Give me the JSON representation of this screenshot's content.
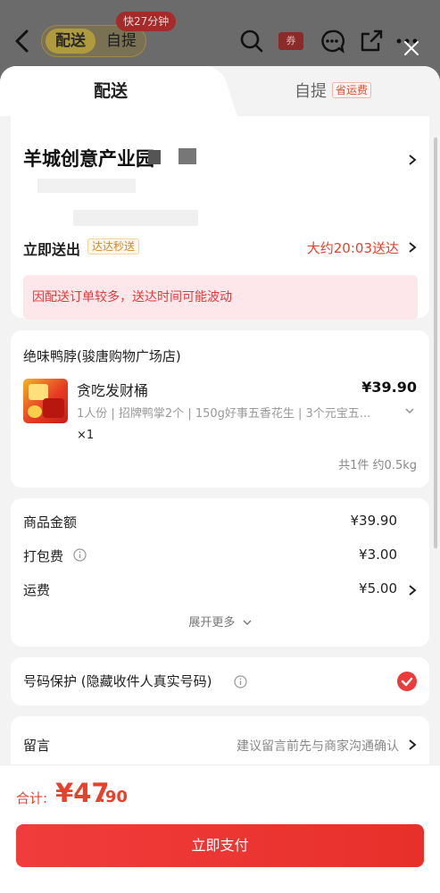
{
  "topbar": {
    "mode_delivery": "配送",
    "mode_pickup": "自提",
    "fast_badge": "快27分钟",
    "coupon_label": "券"
  },
  "tabs": {
    "delivery": "配送",
    "pickup": "自提",
    "pickup_badge": "省运费"
  },
  "address": {
    "title": "羊城创意产业园",
    "deliver_now": "立即送出",
    "fast_tag": "达达秒送",
    "eta": "大约20:03送达",
    "warning": "因配送订单较多，送达时间可能波动"
  },
  "order": {
    "store": "绝味鸭脖(骏唐购物广场店)",
    "product": {
      "name": "贪吃发财桶",
      "price": "¥39.90",
      "spec": "1人份 | 招牌鸭掌2个 | 150g好事五香花生 | 3个元宝五...",
      "qty": "×1"
    },
    "summary": "共1件 约0.5kg"
  },
  "fees": {
    "rows": [
      {
        "label": "商品金额",
        "value": "¥39.90"
      },
      {
        "label": "打包费",
        "value": "¥3.00"
      },
      {
        "label": "运费",
        "value": "¥5.00"
      }
    ],
    "expand": "展开更多"
  },
  "privacy": {
    "label": "号码保护 (隐藏收件人真实号码)",
    "checked": true
  },
  "note": {
    "label": "留言",
    "hint": "建议留言前先与商家沟通确认"
  },
  "total": {
    "label": "合计:",
    "int": "¥47",
    "dec": ".90"
  },
  "pay_button": "立即支付",
  "colors": {
    "accent": "#e8402a",
    "check": "#ec3b3b"
  }
}
